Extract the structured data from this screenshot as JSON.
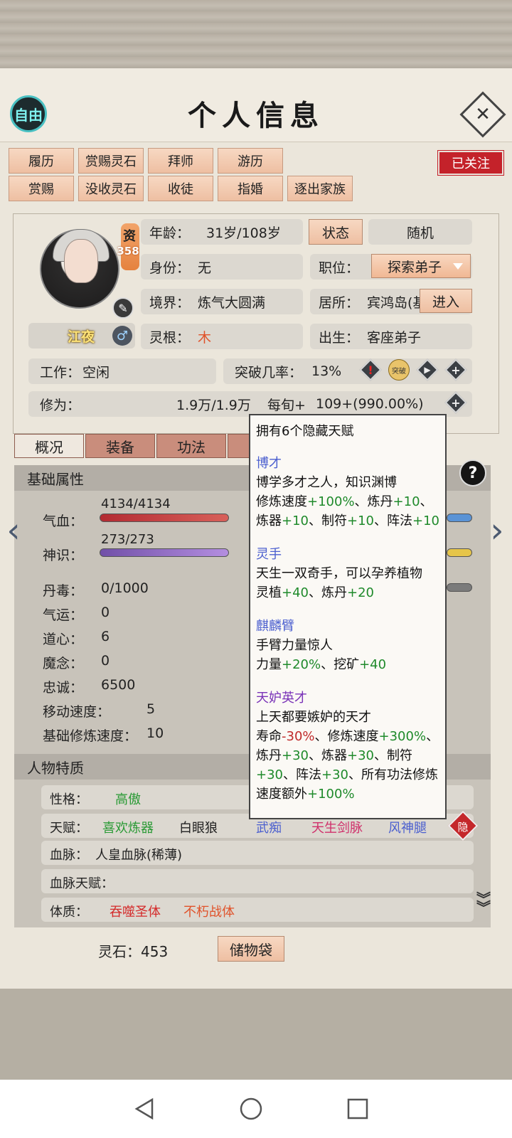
{
  "header": {
    "title": "个人信息",
    "free_label": "自由",
    "close_glyph": "✕"
  },
  "actions": {
    "row1": [
      "履历",
      "赏赐灵石",
      "拜师",
      "游历"
    ],
    "row2": [
      "赏赐",
      "没收灵石",
      "收徒",
      "指婚",
      "逐出家族"
    ],
    "followed_label": "已关注"
  },
  "profile": {
    "zi_label": "资",
    "zi_value": "358",
    "name": "江夜",
    "age_label": "年龄：",
    "age_value": "31岁/108岁",
    "status_button": "状态",
    "random_label": "随机",
    "identity_label": "身份：",
    "identity_value": "无",
    "position_label": "职位：",
    "position_value": "探索弟子",
    "realm_label": "境界：",
    "realm_value": "炼气大圆满",
    "residence_label": "居所：",
    "residence_value": "宾鸿岛(基",
    "enter_button": "进入",
    "root_label": "灵根：",
    "root_value": "木",
    "birth_label": "出生：",
    "birth_value": "客座弟子",
    "work_label": "工作：",
    "work_value": "空闲",
    "break_label": "突破几率：",
    "break_value": "13%",
    "break_icon_text": "突破",
    "cultivation_label": "修为：",
    "cultivation_value": "1.9万/1.9万",
    "per_turn_label": "每旬+",
    "per_turn_value": "109+(990.00%)"
  },
  "tabs": [
    "概况",
    "装备",
    "功法"
  ],
  "basic": {
    "title": "基础属性",
    "hp_label": "气血：",
    "hp_value": "4134/4134",
    "sense_label": "神识：",
    "sense_value": "273/273",
    "stats": [
      {
        "label": "丹毒：",
        "value": "0/1000"
      },
      {
        "label": "气运：",
        "value": "0"
      },
      {
        "label": "道心：",
        "value": "6"
      },
      {
        "label": "魔念：",
        "value": "0"
      },
      {
        "label": "忠诚：",
        "value": "6500"
      },
      {
        "label": "移动速度：",
        "value": "5"
      },
      {
        "label": "基础修炼速度：",
        "value": "10"
      }
    ]
  },
  "traits": {
    "title": "人物特质",
    "personality_label": "性格：",
    "personality_value": "高傲",
    "talent_label": "天赋：",
    "talent_values": [
      "喜欢炼器",
      "白眼狼",
      "武痴",
      "天生剑脉",
      "风神腿"
    ],
    "hide_badge": "隐",
    "bloodline_label": "血脉：",
    "bloodline_value": "人皇血脉(稀薄)",
    "bloodline_talent_label": "血脉天赋：",
    "body_label": "体质：",
    "body_values": [
      "吞噬圣体",
      "不朽战体"
    ]
  },
  "footer": {
    "stone_label": "灵石：453",
    "bag_button": "储物袋"
  },
  "tooltip": {
    "head": "拥有6个隐藏天赋",
    "talents": [
      {
        "name": "博才",
        "desc": "博学多才之人，知识渊博"
      },
      {
        "name": "灵手",
        "desc": "天生一双奇手，可以孕养植物"
      },
      {
        "name": "麒麟臂",
        "desc": "手臂力量惊人"
      },
      {
        "name": "天妒英才",
        "desc": "上天都要嫉妒的天才"
      }
    ],
    "effects": {
      "t0": [
        "修炼速度",
        "+100%",
        "、炼丹",
        "+10",
        "、",
        "炼器",
        "+10",
        "、制符",
        "+10",
        "、阵法",
        "+10"
      ],
      "t1": [
        "灵植",
        "+40",
        "、炼丹",
        "+20"
      ],
      "t2": [
        "力量",
        "+20%",
        "、挖矿",
        "+40"
      ],
      "t3": [
        "寿命",
        "-30%",
        "、修炼速度",
        "+300%",
        "、",
        "炼丹",
        "+30",
        "、炼器",
        "+30",
        "、制符",
        "+30",
        "、阵法",
        "+30",
        "、所有功法修炼",
        "速度额外",
        "+100%"
      ]
    }
  },
  "colors": {
    "accent_red": "#c4222a",
    "talent_blue": "#4b5fcf",
    "talent_purple": "#7a33b8",
    "positive_green": "#1f8a2b",
    "negative_red": "#c02b2b"
  },
  "icons": [
    "free-icon",
    "close-icon",
    "pen-icon",
    "male-icon",
    "danger-icon",
    "breakthrough-icon",
    "play-icon",
    "plus-icon",
    "help-icon",
    "left-arrow-icon",
    "right-arrow-icon",
    "double-chevron-down-icon",
    "nav-back-icon",
    "nav-home-icon",
    "nav-recent-icon"
  ],
  "stat_bars": {
    "hp_fill": 1.0,
    "sense_fill": 1.0
  }
}
